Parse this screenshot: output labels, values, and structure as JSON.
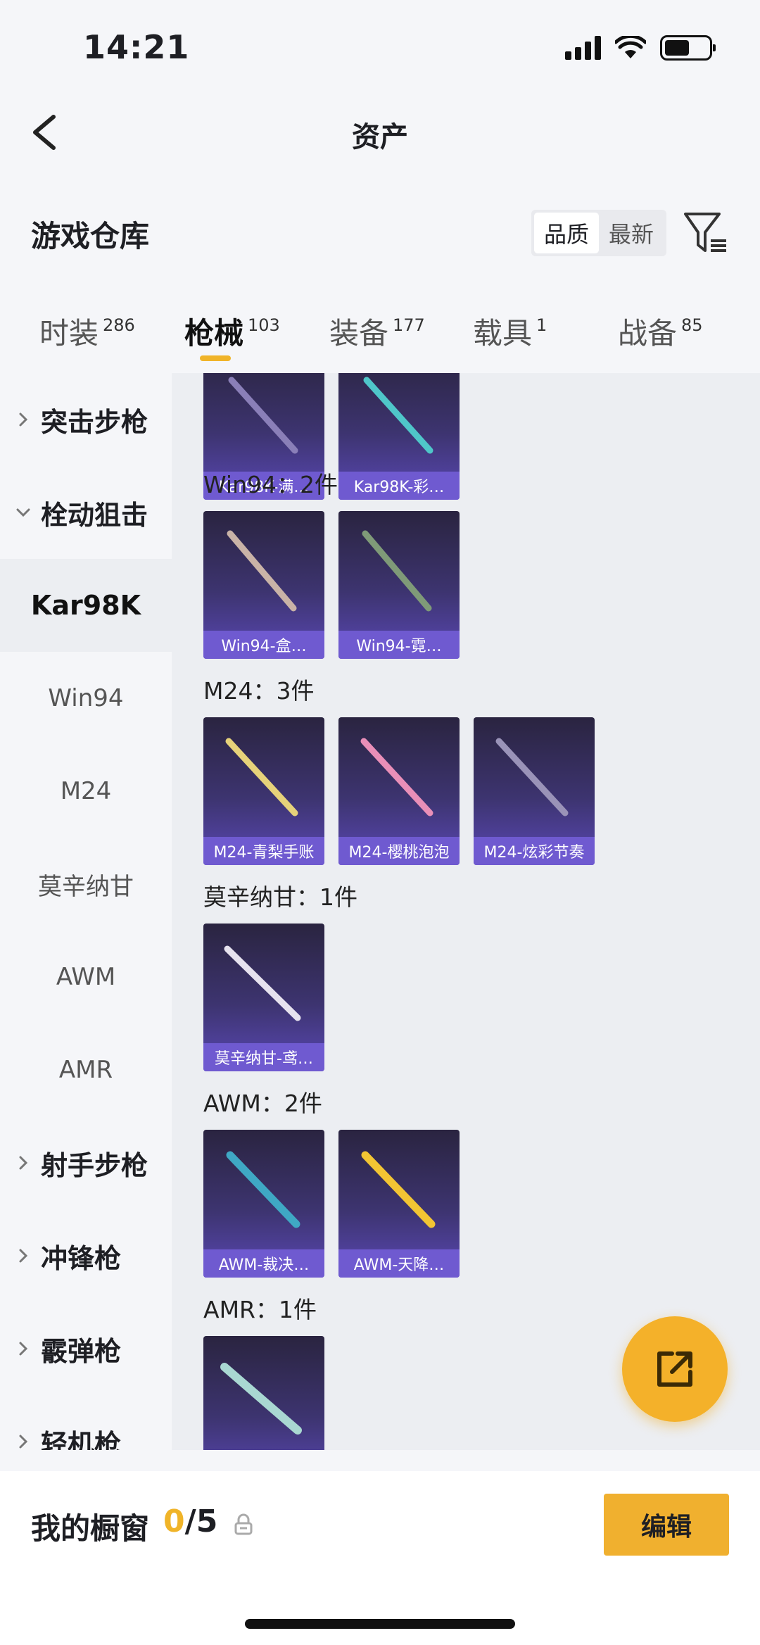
{
  "status": {
    "time": "14:21"
  },
  "nav": {
    "title": "资产"
  },
  "warehouse": {
    "title": "游戏仓库",
    "sort_options": [
      "品质",
      "最新"
    ],
    "sort_selected": "品质"
  },
  "tabs": [
    {
      "label": "时装",
      "count": "286"
    },
    {
      "label": "枪械",
      "count": "103",
      "active": true
    },
    {
      "label": "装备",
      "count": "177"
    },
    {
      "label": "载具",
      "count": "1"
    },
    {
      "label": "战备",
      "count": "85"
    }
  ],
  "sidebar": {
    "items": [
      {
        "label": "突击步枪",
        "type": "category",
        "expanded": false
      },
      {
        "label": "栓动狙击",
        "type": "category",
        "expanded": true
      },
      {
        "label": "Kar98K",
        "type": "sub",
        "active": true
      },
      {
        "label": "Win94",
        "type": "sub"
      },
      {
        "label": "M24",
        "type": "sub"
      },
      {
        "label": "莫辛纳甘",
        "type": "sub"
      },
      {
        "label": "AWM",
        "type": "sub"
      },
      {
        "label": "AMR",
        "type": "sub"
      },
      {
        "label": "射手步枪",
        "type": "category",
        "expanded": false
      },
      {
        "label": "冲锋枪",
        "type": "category",
        "expanded": false
      },
      {
        "label": "霰弹枪",
        "type": "category",
        "expanded": false
      },
      {
        "label": "轻机枪",
        "type": "category",
        "expanded": false
      }
    ]
  },
  "content": {
    "groups": [
      {
        "label": "",
        "items": [
          {
            "name": "Kar98K-满…",
            "gun_color": "#8a7fb8"
          },
          {
            "name": "Kar98K-彩…",
            "gun_color": "#4fc6c9"
          }
        ]
      },
      {
        "label": "Win94：2件",
        "items": [
          {
            "name": "Win94-盒…",
            "gun_color": "#c9b3a7"
          },
          {
            "name": "Win94-霓…",
            "gun_color": "#7f9a78"
          }
        ]
      },
      {
        "label": "M24：3件",
        "items": [
          {
            "name": "M24-青梨手账",
            "gun_color": "#e6d27a"
          },
          {
            "name": "M24-樱桃泡泡",
            "gun_color": "#e98fb8"
          },
          {
            "name": "M24-炫彩节奏",
            "gun_color": "#9a93b8"
          }
        ]
      },
      {
        "label": "莫辛纳甘：1件",
        "items": [
          {
            "name": "莫辛纳甘-鸢…",
            "gun_color": "#e6e2ee"
          }
        ]
      },
      {
        "label": "AWM：2件",
        "items": [
          {
            "name": "AWM-裁决…",
            "gun_color": "#3fa8c4"
          },
          {
            "name": "AWM-天降…",
            "gun_color": "#f2c533"
          }
        ]
      },
      {
        "label": "AMR：1件",
        "items": [
          {
            "name": "",
            "gun_color": "#a9d8d2"
          }
        ]
      }
    ]
  },
  "bottom": {
    "window_label": "我的橱窗",
    "window_current": "0",
    "window_total": "/5",
    "edit_label": "编辑"
  },
  "colors": {
    "accent": "#f0b429",
    "card_label": "#6f5ad0"
  }
}
